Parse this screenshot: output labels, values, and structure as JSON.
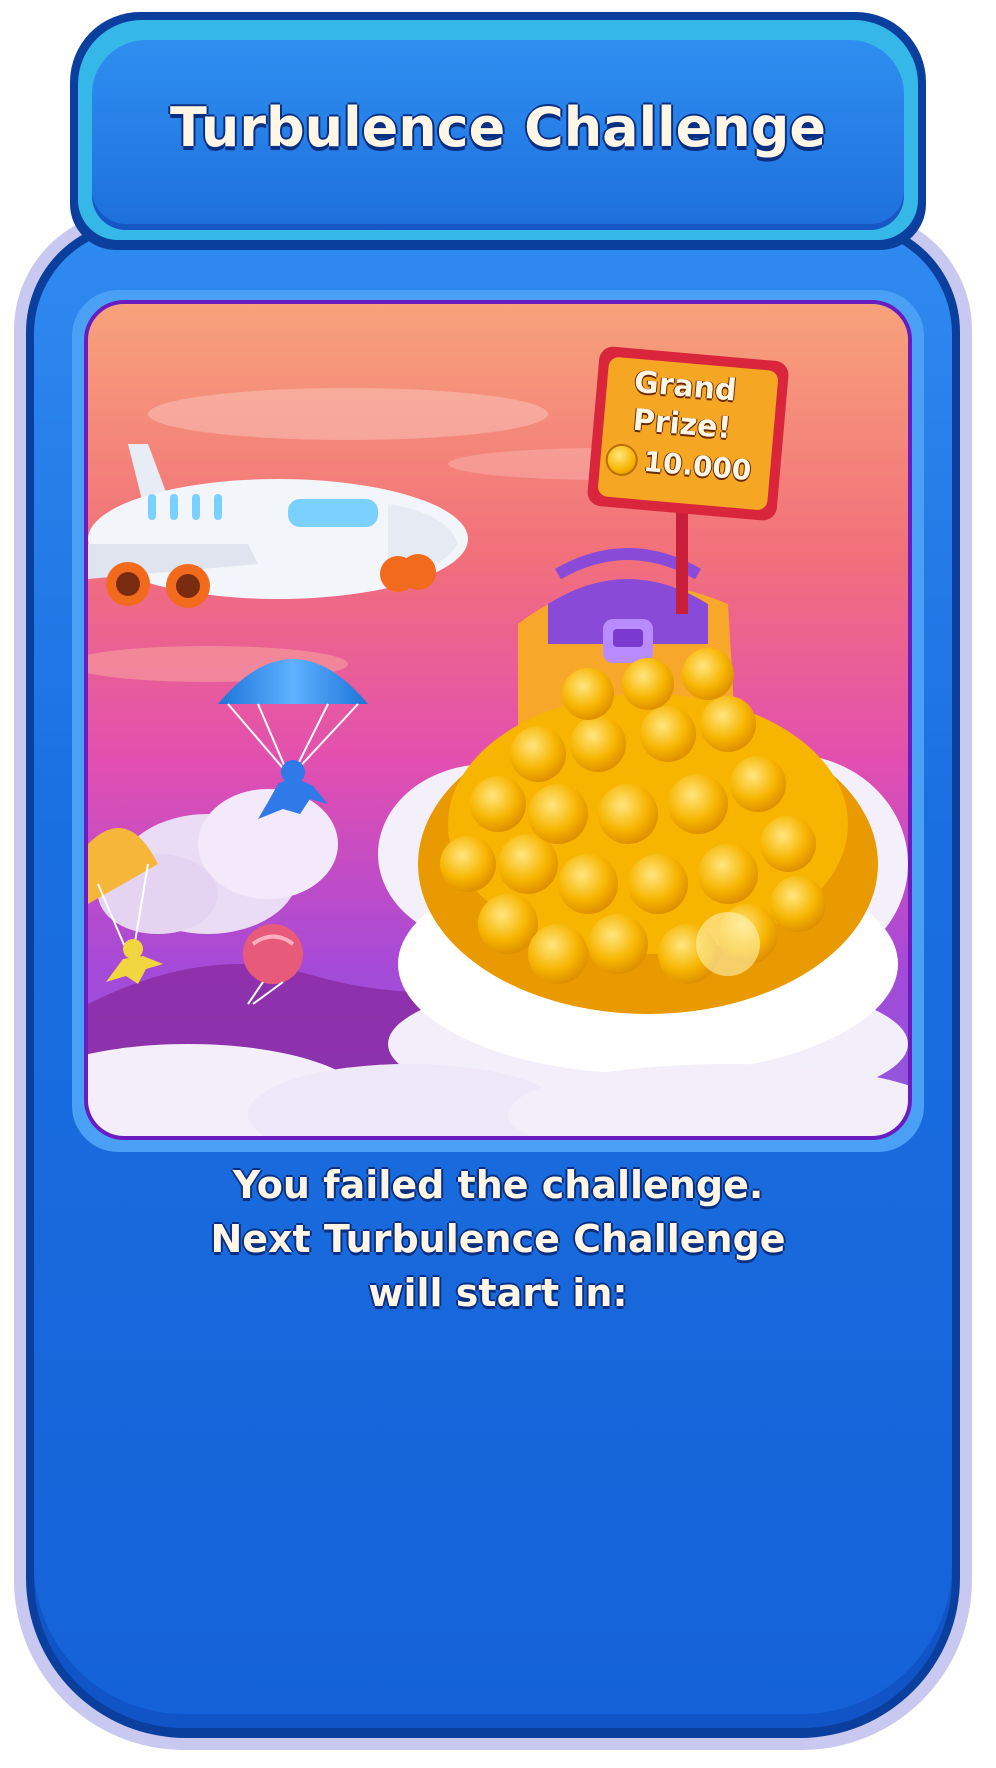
{
  "header": {
    "title": "Turbulence Challenge"
  },
  "artwork": {
    "sign": {
      "line1": "Grand",
      "line2": "Prize!",
      "amount": "10.000",
      "icon": "coin-icon"
    }
  },
  "message": {
    "line1": "You failed the challenge.",
    "line2": "Next Turbulence Challenge",
    "line3": "will start in:"
  },
  "colors": {
    "panel": "#1a6fe0",
    "panel_border": "#0b3f9e",
    "header_rim": "#35b8e8",
    "art_border": "#6a1cc0",
    "text": "#fff6e6",
    "sign": "#f5a623",
    "sign_border": "#d9263c",
    "coin": "#f7b500"
  }
}
